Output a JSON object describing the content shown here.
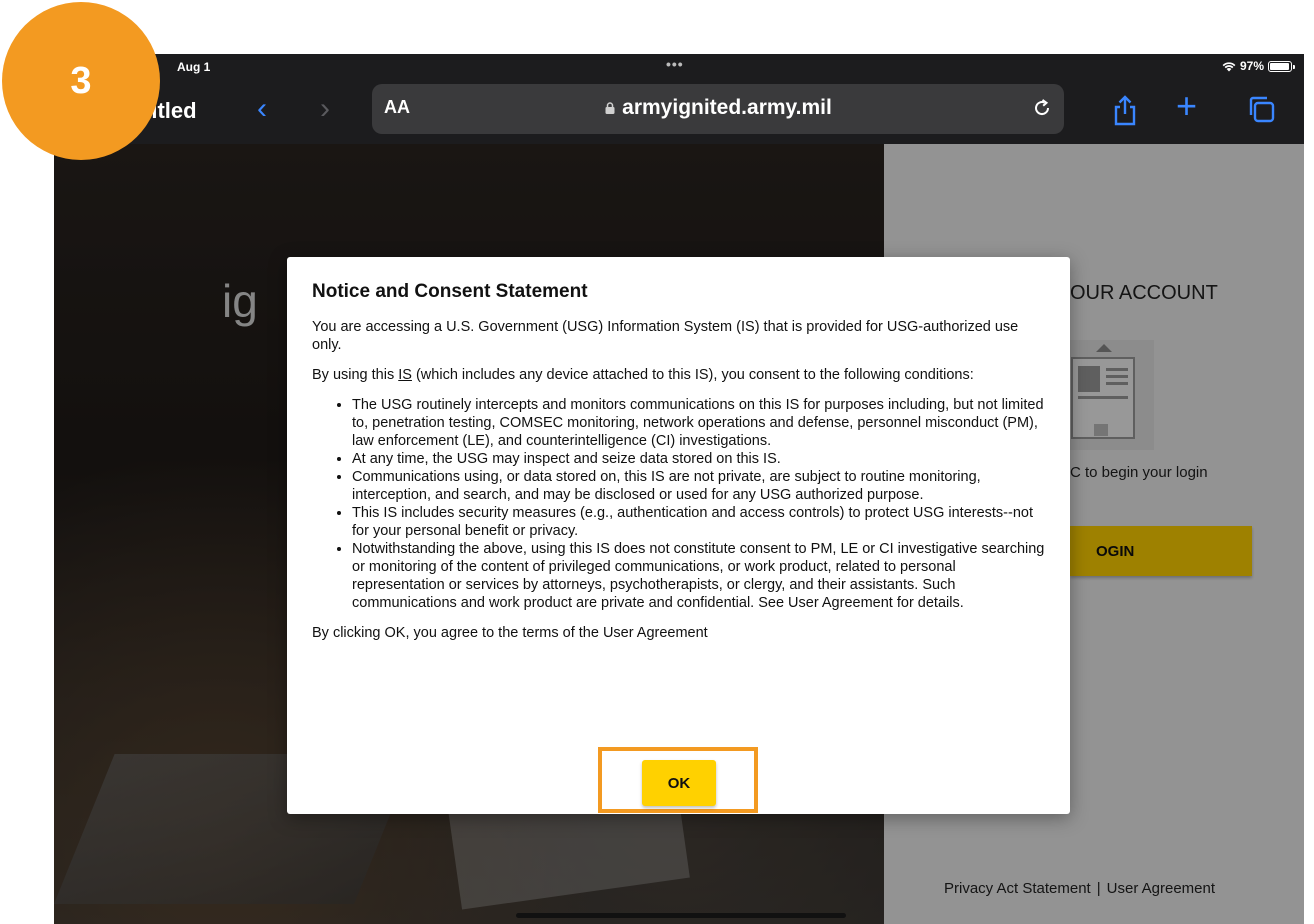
{
  "step_badge": {
    "number": "3",
    "color": "#F39A21"
  },
  "status_bar": {
    "date": "Aug 1",
    "dots": "•••",
    "battery": "97%"
  },
  "toolbar": {
    "tab_title": "titled",
    "text_size_button": "AA",
    "url": "armyignited.army.mil",
    "accent_color": "#3a86ff"
  },
  "hero": {
    "logo_text": "ig"
  },
  "account_panel": {
    "title": "OUR ACCOUNT",
    "instruction": "C to begin your login",
    "login_button": "OGIN",
    "footer": {
      "privacy_link": "Privacy Act Statement",
      "separator": "|",
      "agreement_link": "User Agreement"
    }
  },
  "modal": {
    "title": "Notice and Consent Statement",
    "intro": "You are accessing a U.S. Government (USG) Information System (IS) that is provided for USG-authorized use only.",
    "consent_prefix": "By using this ",
    "consent_is": "IS",
    "consent_suffix": " (which includes any device attached to this IS), you consent to the following conditions:",
    "conditions": [
      "The USG routinely intercepts and monitors communications on this IS for purposes including, but not limited to, penetration testing, COMSEC monitoring, network operations and defense, personnel misconduct (PM), law enforcement (LE), and counterintelligence (CI) investigations.",
      "At any time, the USG may inspect and seize data stored on this IS.",
      "Communications using, or data stored on, this IS are not private, are subject to routine monitoring, interception, and search, and may be disclosed or used for any USG authorized purpose.",
      "This IS includes security measures (e.g., authentication and access controls) to protect USG interests--not for your personal benefit or privacy.",
      "Notwithstanding the above, using this IS does not constitute consent to PM, LE or CI investigative searching or monitoring of the content of privileged communications, or work product, related to personal representation or services by attorneys, psychotherapists, or clergy, and their assistants. Such communications and work product are private and confidential. See User Agreement for details."
    ],
    "agreement": "By clicking OK, you agree to the terms of the User Agreement",
    "ok_button": "OK",
    "button_color": "#FFD100"
  }
}
